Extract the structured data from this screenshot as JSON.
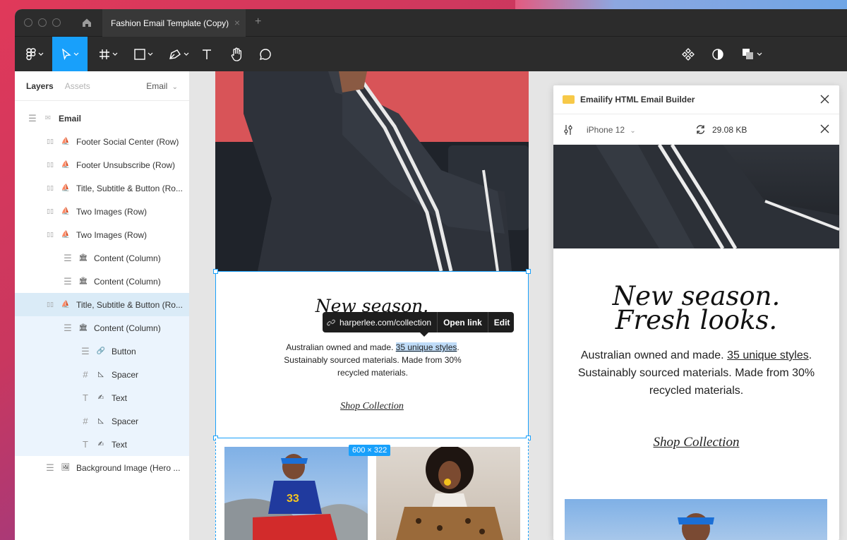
{
  "window": {
    "tab_title": "Fashion Email Template (Copy)",
    "tab_close": "×",
    "tab_add": "+"
  },
  "toolbar": {
    "tools": [
      "figma-menu",
      "move",
      "frame",
      "shape",
      "pen",
      "text",
      "hand",
      "comment"
    ],
    "active_tool": "move",
    "accent": "#18a0fb"
  },
  "layers": {
    "tab_layers": "Layers",
    "tab_assets": "Assets",
    "page": "Email",
    "page_chevron": "⌄",
    "items": [
      {
        "label": "Email",
        "indent": 0,
        "icon": "frame-icon"
      },
      {
        "label": "Footer Social Center (Row)",
        "indent": 1,
        "icon": "row-icon"
      },
      {
        "label": "Footer Unsubscribe (Row)",
        "indent": 1,
        "icon": "row-icon"
      },
      {
        "label": "Title, Subtitle & Button (Ro...",
        "indent": 1,
        "icon": "row-icon"
      },
      {
        "label": "Two Images (Row)",
        "indent": 1,
        "icon": "row-icon"
      },
      {
        "label": "Two Images (Row)",
        "indent": 1,
        "icon": "row-icon"
      },
      {
        "label": "Content (Column)",
        "indent": 2,
        "icon": "column-icon"
      },
      {
        "label": "Content (Column)",
        "indent": 2,
        "icon": "column-icon"
      },
      {
        "label": "Title, Subtitle & Button (Ro...",
        "indent": 1,
        "icon": "row-icon",
        "selected": true
      },
      {
        "label": "Content (Column)",
        "indent": 2,
        "icon": "column-icon"
      },
      {
        "label": "Button",
        "indent": 3,
        "icon": "button-icon"
      },
      {
        "label": "Spacer",
        "indent": 3,
        "icon": "spacer-icon"
      },
      {
        "label": "Text",
        "indent": 3,
        "icon": "text-icon"
      },
      {
        "label": "Spacer",
        "indent": 3,
        "icon": "spacer-icon"
      },
      {
        "label": "Text",
        "indent": 3,
        "icon": "text-icon"
      },
      {
        "label": "Background Image (Hero ...",
        "indent": 1,
        "icon": "hero-icon"
      }
    ]
  },
  "canvas": {
    "title_line1": "New season.",
    "body_before": "Australian owned and made. ",
    "body_link": "35 unique styles",
    "body_after": ". Sustainably sourced materials. Made from 30% recycled materials.",
    "cta": "Shop Collection",
    "link_tooltip": {
      "url": "harperlee.com/collection",
      "open": "Open link",
      "edit": "Edit"
    },
    "size_badge": "600 × 322"
  },
  "plugin": {
    "title": "Emailify HTML Email Builder",
    "device": "iPhone 12",
    "file_size": "29.08 KB",
    "preview_title_line1": "New season.",
    "preview_title_line2": "Fresh looks.",
    "preview_body_before": "Australian owned and made. ",
    "preview_body_link": "35 unique styles",
    "preview_body_after": ". Sustainably sourced materials. Made from 30% recycled materials.",
    "preview_cta": "Shop Collection"
  }
}
